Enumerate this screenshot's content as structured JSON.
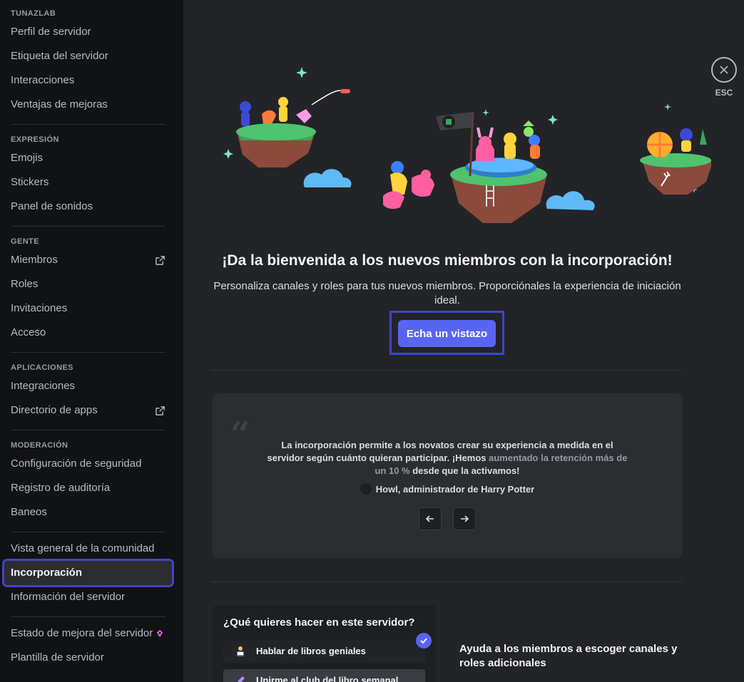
{
  "sidebar": {
    "groups": [
      {
        "header": "TUNAZLAB",
        "items": [
          {
            "label": "Perfil de servidor"
          },
          {
            "label": "Etiqueta del servidor"
          },
          {
            "label": "Interacciones"
          },
          {
            "label": "Ventajas de mejoras"
          }
        ]
      },
      {
        "header": "EXPRESIÓN",
        "items": [
          {
            "label": "Emojis"
          },
          {
            "label": "Stickers"
          },
          {
            "label": "Panel de sonidos"
          }
        ]
      },
      {
        "header": "GENTE",
        "items": [
          {
            "label": "Miembros",
            "icon": "external-link-icon"
          },
          {
            "label": "Roles"
          },
          {
            "label": "Invitaciones"
          },
          {
            "label": "Acceso"
          }
        ]
      },
      {
        "header": "APLICACIONES",
        "items": [
          {
            "label": "Integraciones"
          },
          {
            "label": "Directorio de apps",
            "icon": "external-link-icon"
          }
        ]
      },
      {
        "header": "MODERACIÓN",
        "items": [
          {
            "label": "Configuración de seguridad"
          },
          {
            "label": "Registro de auditoría"
          },
          {
            "label": "Baneos"
          }
        ]
      },
      {
        "header": "",
        "items": [
          {
            "label": "Vista general de la comunidad"
          },
          {
            "label": "Incorporación",
            "selected": true
          },
          {
            "label": "Información del servidor"
          }
        ]
      },
      {
        "header": "",
        "items": [
          {
            "label": "Estado de mejora del servidor",
            "icon": "boost-gem-icon"
          },
          {
            "label": "Plantilla de servidor"
          }
        ]
      }
    ]
  },
  "close": {
    "label": "ESC",
    "icon": "close-icon"
  },
  "main": {
    "title": "¡Da la bienvenida a los nuevos miembros con la incorporación!",
    "subtitle": "Personaliza canales y roles para tus nuevos miembros. Proporciónales la experiencia de iniciación ideal.",
    "cta_label": "Echa un vistazo"
  },
  "testimonial": {
    "text_before": "La incorporación permite a los novatos crear su experiencia a medida en el servidor según cuánto quieran participar. ¡Hemos ",
    "text_highlight": "aumentado la retención más de un 10 %",
    "text_after": " desde que la activamos!",
    "author": "Howl, administrador de Harry Potter",
    "prev_icon": "arrow-left-icon",
    "next_icon": "arrow-right-icon"
  },
  "question": {
    "title": "¿Qué quieres hacer en este servidor?",
    "options": [
      {
        "label": "Hablar de libros geniales",
        "checked": true
      },
      {
        "label": "Unirme al club del libro semanal"
      }
    ]
  },
  "help_text": "Ayuda a los miembros a escoger canales y roles adicionales",
  "colors": {
    "accent": "#5865f2",
    "focus_outline": "#4046c3",
    "sidebar_bg": "#111214",
    "main_bg": "#232428"
  }
}
